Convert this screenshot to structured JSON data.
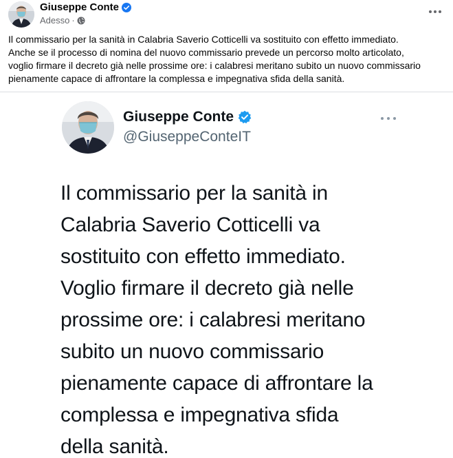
{
  "post": {
    "author_name": "Giuseppe Conte",
    "timestamp": "Adesso",
    "separator": "·",
    "text_lines": [
      "Il commissario per la sanità in Calabria Saverio Cotticelli va sostituito con effetto immediato.",
      "Anche se il processo di nomina del nuovo commissario prevede un percorso molto articolato,",
      "voglio firmare il decreto già nelle prossime ore: i calabresi meritano subito un nuovo commissario",
      "pienamente capace di affrontare la complessa e impegnativa sfida della sanità."
    ]
  },
  "tweet": {
    "name": "Giuseppe Conte",
    "handle": "@GiuseppeConteIT",
    "text_lines": [
      "Il commissario per la sanità in",
      "Calabria Saverio Cotticelli va",
      "sostituito con effetto immediato.",
      "Voglio firmare il decreto già nelle",
      "prossime ore: i calabresi meritano",
      "subito un nuovo commissario",
      "pienamente capace di affrontare la",
      "complessa e impegnativa sfida",
      "della sanità."
    ]
  },
  "colors": {
    "verified_blue": "#1877f2",
    "twitter_verified_blue": "#1d9bf0",
    "meta_gray": "#65676b"
  },
  "icons": {
    "fb_verified": "verified-badge-icon",
    "privacy": "globe-icon",
    "menu": "more-options-icon"
  }
}
